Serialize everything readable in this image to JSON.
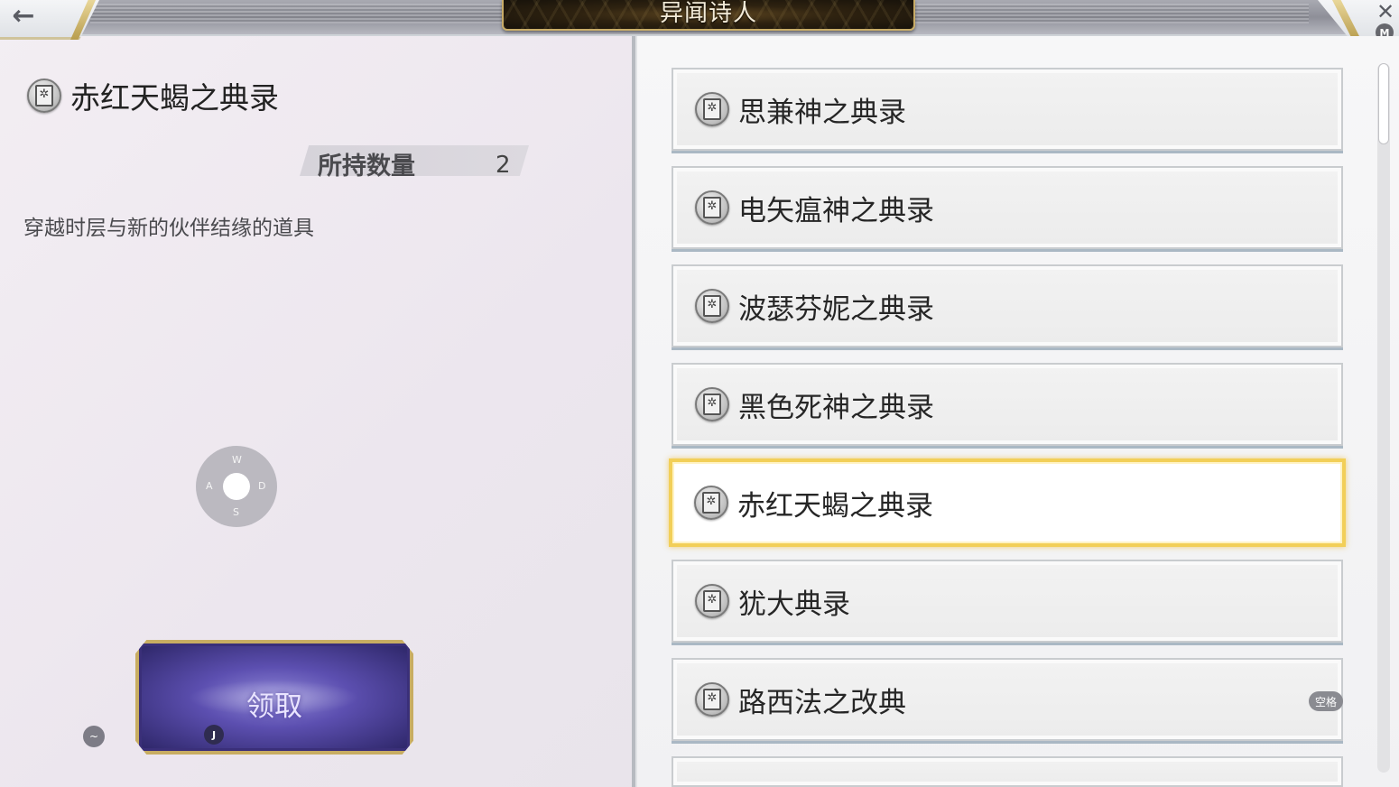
{
  "header": {
    "title": "异闻诗人",
    "back_icon": "←",
    "close_icon": "✕",
    "map_key": "M"
  },
  "detail": {
    "item_name": "赤红天蝎之典录",
    "quantity_label": "所持数量",
    "quantity_value": "2",
    "description": "穿越时层与新的伙伴结缘的道具",
    "claim_label": "领取",
    "claim_key": "J",
    "tilde_key": "~",
    "wasd": {
      "up": "W",
      "left": "A",
      "right": "D",
      "down": "S"
    }
  },
  "list": {
    "items": [
      {
        "label": "思兼神之典录",
        "selected": false
      },
      {
        "label": "电矢瘟神之典录",
        "selected": false
      },
      {
        "label": "波瑟芬妮之典录",
        "selected": false
      },
      {
        "label": "黑色死神之典录",
        "selected": false
      },
      {
        "label": "赤红天蝎之典录",
        "selected": true
      },
      {
        "label": "犹大典录",
        "selected": false
      },
      {
        "label": "路西法之改典",
        "selected": false
      }
    ],
    "space_key": "空格"
  },
  "icons": {
    "item_icon": "grimoire-book-icon",
    "book_glyph": "✲"
  },
  "colors": {
    "selected_border": "#f2cf58",
    "title_plate_border": "#c9ad68",
    "claim_button": "#5c4fb0"
  }
}
